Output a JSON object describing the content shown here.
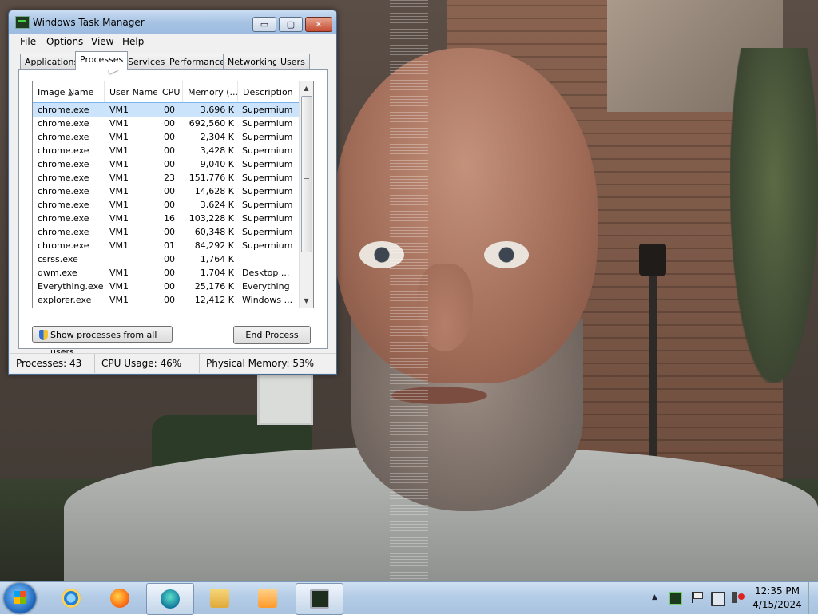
{
  "window": {
    "title": "Windows Task Manager"
  },
  "controls": {
    "minimize": "▭",
    "maximize": "▢",
    "close": "✕"
  },
  "menu": [
    "File",
    "Options",
    "View",
    "Help"
  ],
  "tabs": [
    "Applications",
    "Processes",
    "Services",
    "Performance",
    "Networking",
    "Users"
  ],
  "active_tab": "Processes",
  "columns": [
    "Image Name",
    "User Name",
    "CPU",
    "Memory (...",
    "Description"
  ],
  "processes": [
    {
      "name": "chrome.exe",
      "user": "VM1",
      "cpu": "00",
      "memory": "3,696 K",
      "description": "Supermium"
    },
    {
      "name": "chrome.exe",
      "user": "VM1",
      "cpu": "00",
      "memory": "692,560 K",
      "description": "Supermium"
    },
    {
      "name": "chrome.exe",
      "user": "VM1",
      "cpu": "00",
      "memory": "2,304 K",
      "description": "Supermium"
    },
    {
      "name": "chrome.exe",
      "user": "VM1",
      "cpu": "00",
      "memory": "3,428 K",
      "description": "Supermium"
    },
    {
      "name": "chrome.exe",
      "user": "VM1",
      "cpu": "00",
      "memory": "9,040 K",
      "description": "Supermium"
    },
    {
      "name": "chrome.exe",
      "user": "VM1",
      "cpu": "23",
      "memory": "151,776 K",
      "description": "Supermium"
    },
    {
      "name": "chrome.exe",
      "user": "VM1",
      "cpu": "00",
      "memory": "14,628 K",
      "description": "Supermium"
    },
    {
      "name": "chrome.exe",
      "user": "VM1",
      "cpu": "00",
      "memory": "3,624 K",
      "description": "Supermium"
    },
    {
      "name": "chrome.exe",
      "user": "VM1",
      "cpu": "16",
      "memory": "103,228 K",
      "description": "Supermium"
    },
    {
      "name": "chrome.exe",
      "user": "VM1",
      "cpu": "00",
      "memory": "60,348 K",
      "description": "Supermium"
    },
    {
      "name": "chrome.exe",
      "user": "VM1",
      "cpu": "01",
      "memory": "84,292 K",
      "description": "Supermium"
    },
    {
      "name": "csrss.exe",
      "user": "",
      "cpu": "00",
      "memory": "1,764 K",
      "description": ""
    },
    {
      "name": "dwm.exe",
      "user": "VM1",
      "cpu": "00",
      "memory": "1,704 K",
      "description": "Desktop ..."
    },
    {
      "name": "Everything.exe",
      "user": "VM1",
      "cpu": "00",
      "memory": "25,176 K",
      "description": "Everything"
    },
    {
      "name": "explorer.exe",
      "user": "VM1",
      "cpu": "00",
      "memory": "12,412 K",
      "description": "Windows ..."
    }
  ],
  "selected_row": 0,
  "buttons": {
    "show_all": "Show processes from all users",
    "end_process": "End Process"
  },
  "status": {
    "processes": "Processes: 43",
    "cpu": "CPU Usage: 46%",
    "memory": "Physical Memory: 53%"
  },
  "taskbar": {
    "apps": [
      {
        "name": "Internet Explorer",
        "icon": "ie-icon",
        "active": false
      },
      {
        "name": "Firefox",
        "icon": "firefox-icon",
        "active": false
      },
      {
        "name": "Supermium",
        "icon": "edge-icon",
        "active": true
      },
      {
        "name": "Windows Explorer",
        "icon": "folder-icon",
        "active": false
      },
      {
        "name": "Media Player",
        "icon": "media-player-icon",
        "active": false
      },
      {
        "name": "Task Manager",
        "icon": "task-manager-icon",
        "active": true
      }
    ],
    "clock": {
      "time": "12:35 PM",
      "date": "4/15/2024"
    }
  }
}
